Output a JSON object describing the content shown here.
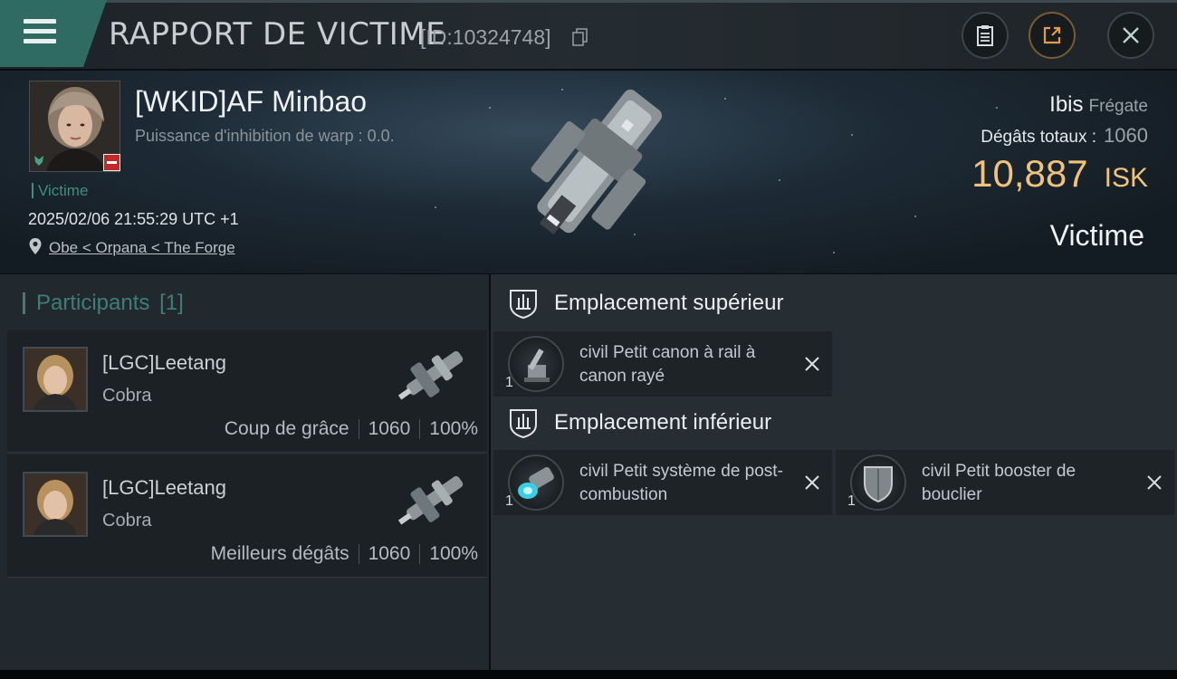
{
  "header": {
    "title": "RAPPORT DE VICTIME",
    "id_text": "[ID:10324748]",
    "icons": [
      "menu-icon",
      "copy-icon",
      "clipboard-icon",
      "share-icon",
      "close-icon"
    ]
  },
  "victim": {
    "name": "[WKID]AF Minbao",
    "warp_text": "Puissance d'inhibition de warp : 0.0.",
    "role_label": "Victime",
    "datetime": "2025/02/06 21:55:29 UTC +1",
    "location": "Obe < Orpana < The Forge",
    "ship_name": "Ibis",
    "ship_class": "Frégate",
    "damage_label": "Dégâts totaux :",
    "damage_value": "1060",
    "isk_amount": "10,887",
    "isk_currency": "ISK",
    "result_label": "Victime"
  },
  "participants": {
    "title": "Participants",
    "count": "[1]",
    "rows": [
      {
        "name": "[LGC]Leetang",
        "ship": "Cobra",
        "role": "Coup de grâce",
        "damage": "1060",
        "percent": "100%"
      },
      {
        "name": "[LGC]Leetang",
        "ship": "Cobra",
        "role": "Meilleurs dégâts",
        "damage": "1060",
        "percent": "100%"
      }
    ]
  },
  "slots": {
    "high": {
      "title": "Emplacement supérieur",
      "modules": [
        {
          "name": "civil Petit canon à rail à canon rayé",
          "qty": "1"
        }
      ]
    },
    "low": {
      "title": "Emplacement inférieur",
      "modules": [
        {
          "name": "civil Petit système de post-combustion",
          "qty": "1"
        },
        {
          "name": "civil Petit booster de bouclier",
          "qty": "1"
        }
      ]
    }
  },
  "colors": {
    "accent_teal": "#2f6a63",
    "isk_gold": "#f0c27a",
    "status_red": "#c12a28"
  }
}
